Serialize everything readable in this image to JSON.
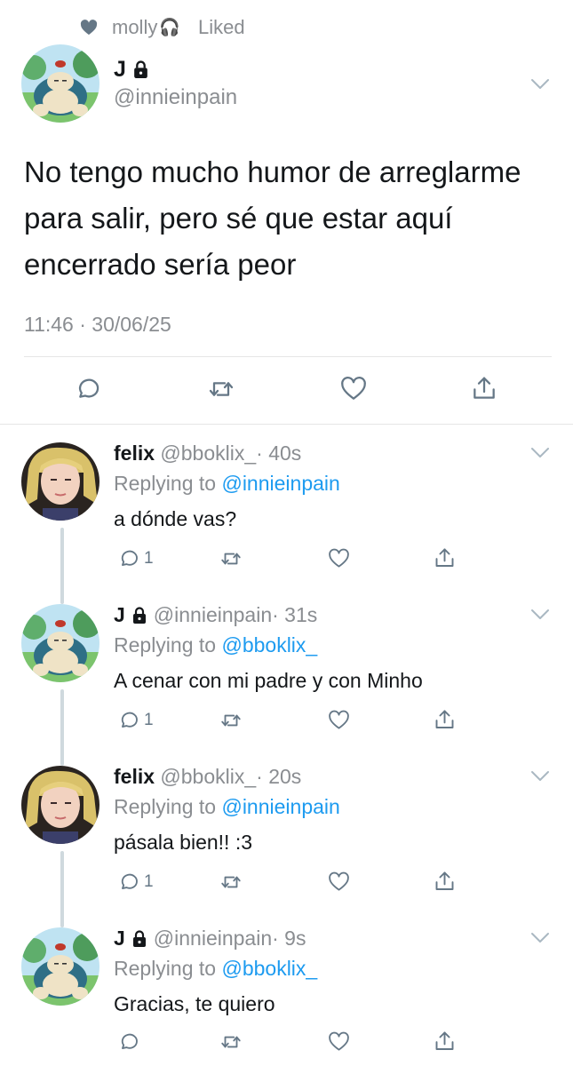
{
  "social_context": {
    "user": "molly",
    "headphones": "🎧",
    "action": "Liked"
  },
  "main_tweet": {
    "name": "J",
    "handle": "@innieinpain",
    "text_lines": [
      "No tengo mucho humor de arreglarme",
      "para salir, pero sé que estar aquí",
      "encerrado sería peor"
    ],
    "timestamp": "11:46 · 30/06/25"
  },
  "replies": [
    {
      "name": "felix",
      "handle": "@bboklix_",
      "time": "· 40s",
      "replying_label": "Replying to",
      "replying_to": "@innieinpain",
      "text": "a dónde vas?",
      "reply_count": "1"
    },
    {
      "name": "J",
      "handle": "@innieinpain",
      "time": "· 31s",
      "replying_label": "Replying to",
      "replying_to": "@bboklix_",
      "text": "A cenar con mi padre y con Minho",
      "reply_count": "1"
    },
    {
      "name": "felix",
      "handle": "@bboklix_",
      "time": "· 20s",
      "replying_label": "Replying to",
      "replying_to": "@innieinpain",
      "text": "pásala bien!! :3",
      "reply_count": "1"
    },
    {
      "name": "J",
      "handle": "@innieinpain",
      "time": "· 9s",
      "replying_label": "Replying to",
      "replying_to": "@bboklix_",
      "text": "Gracias, te quiero",
      "reply_count": ""
    }
  ],
  "colors": {
    "accent": "#1d9bf0",
    "muted": "#8a8d91",
    "icon": "#657786",
    "line": "#cfd9de"
  }
}
